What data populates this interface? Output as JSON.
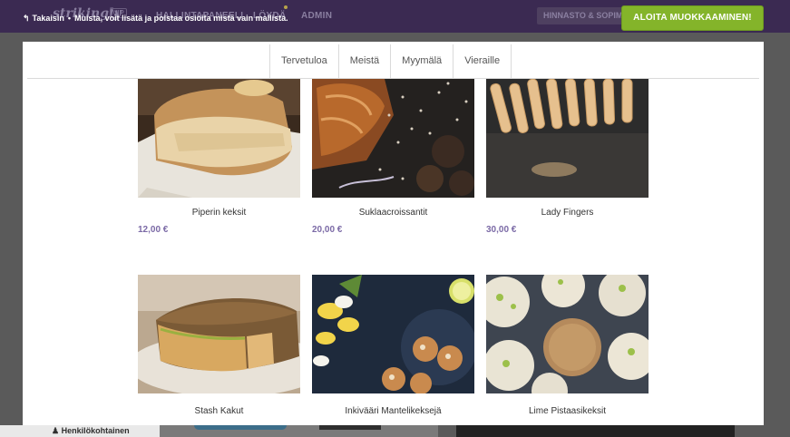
{
  "topbar": {
    "logo": "strikingly",
    "vip": "VIP",
    "nav": [
      "HALLINTAPANEELI",
      "LÖYDÄ",
      "ADMIN"
    ],
    "pricing_label": "HINNASTO & SOPIMUKSET",
    "start_button": "ALOITA MUOKKAAMINEN!"
  },
  "banner": {
    "back": "Takaisin",
    "bullet": "•",
    "note": "Muista, voit lisätä ja poistaa osioita mistä vain mallista."
  },
  "preview": {
    "nav": [
      "Tervetuloa",
      "Meistä",
      "Myymälä",
      "Vieraille"
    ],
    "products": [
      {
        "name": "Piperin keksit",
        "price": "12,00 €",
        "image": "bread-loaf"
      },
      {
        "name": "Suklaacroissantit",
        "price": "20,00 €",
        "image": "chocolate-croissant"
      },
      {
        "name": "Lady Fingers",
        "price": "30,00 €",
        "image": "lady-fingers"
      },
      {
        "name": "Stash Kakut",
        "price": "",
        "image": "quiche-cake"
      },
      {
        "name": "Inkivääri Mantelikeksejä",
        "price": "",
        "image": "almond-cookies"
      },
      {
        "name": "Lime Pistaasikeksit",
        "price": "",
        "image": "pistachio-cookies"
      }
    ]
  },
  "footer": {
    "personal": "Henkilökohtainen"
  },
  "colors": {
    "accent_green": "#84b42a",
    "price_purple": "#7b6aa6",
    "topbar": "#3b2a52"
  }
}
